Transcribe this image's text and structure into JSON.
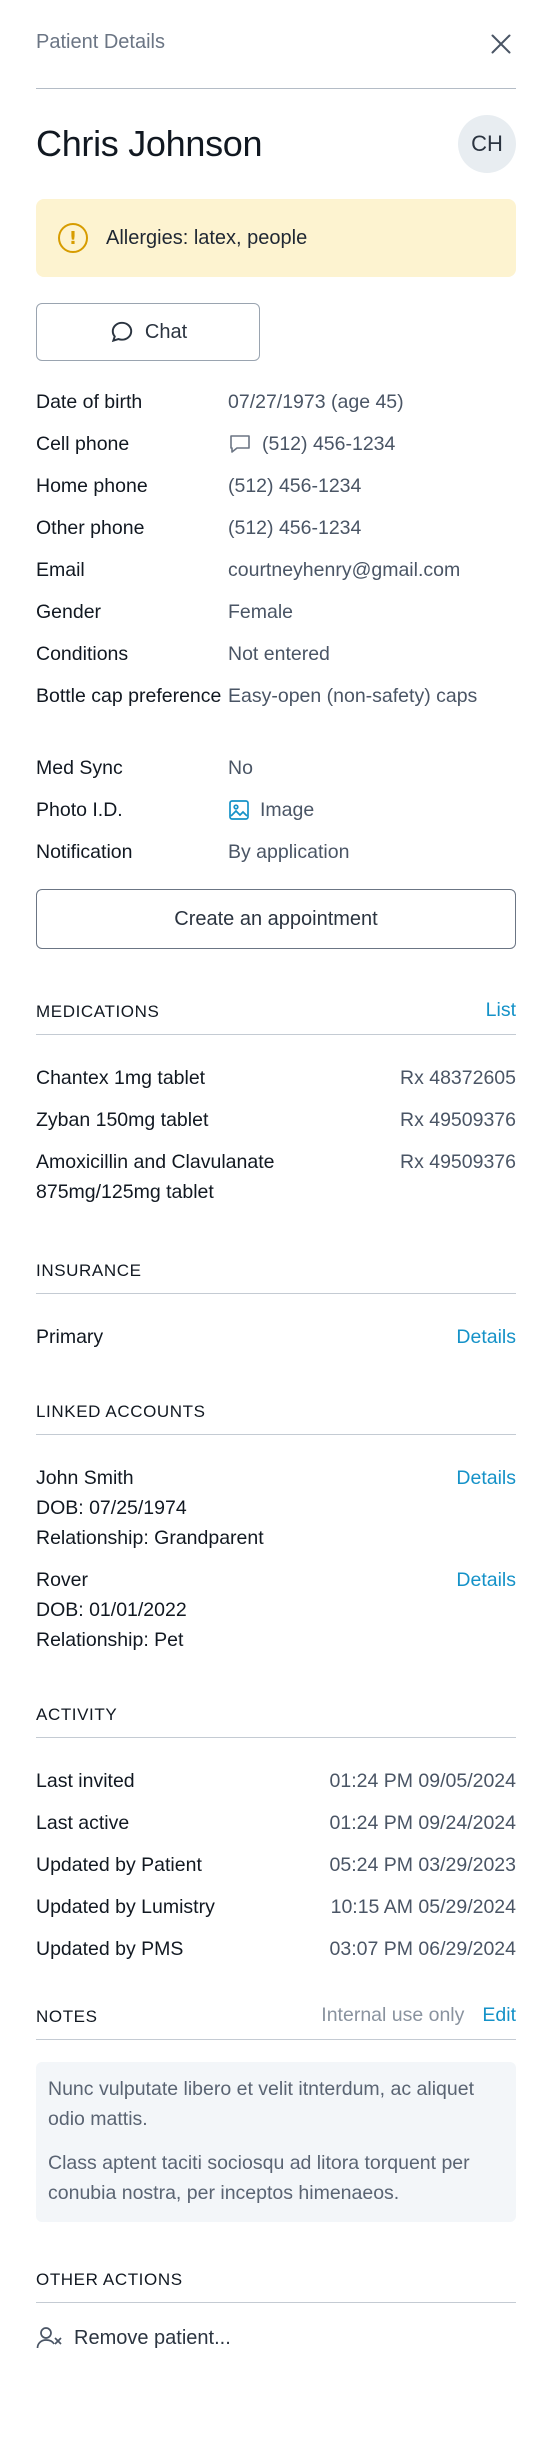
{
  "header": {
    "title": "Patient Details"
  },
  "patient": {
    "name": "Chris Johnson",
    "initials": "CH",
    "allergy_text": "Allergies: latex, people"
  },
  "chat_label": "Chat",
  "fields": [
    {
      "label": "Date of birth",
      "value": "07/27/1973 (age 45)"
    },
    {
      "label": "Cell phone",
      "value": "(512) 456-1234"
    },
    {
      "label": "Home phone",
      "value": "(512) 456-1234"
    },
    {
      "label": "Other phone",
      "value": "(512) 456-1234"
    },
    {
      "label": "Email",
      "value": "courtneyhenry@gmail.com"
    },
    {
      "label": "Gender",
      "value": "Female"
    },
    {
      "label": "Conditions",
      "value": "Not entered"
    },
    {
      "label": "Bottle cap preference",
      "value": "Easy-open (non-safety) caps"
    },
    {
      "label": "Med Sync",
      "value": "No"
    },
    {
      "label": "Photo I.D.",
      "value": "Image"
    },
    {
      "label": "Notification",
      "value": "By application"
    }
  ],
  "appointment_label": "Create an appointment",
  "medications": {
    "title": "MEDICATIONS",
    "action": "List",
    "items": [
      {
        "name": "Chantex 1mg tablet",
        "rx": "Rx 48372605"
      },
      {
        "name": "Zyban 150mg tablet",
        "rx": "Rx 49509376"
      },
      {
        "name": "Amoxicillin and Clavulanate 875mg/125mg tablet",
        "rx": "Rx 49509376"
      }
    ]
  },
  "insurance": {
    "title": "INSURANCE",
    "items": [
      {
        "label": "Primary",
        "action": "Details"
      }
    ]
  },
  "linked": {
    "title": "LINKED ACCOUNTS",
    "items": [
      {
        "name": "John Smith",
        "dob": "DOB: 07/25/1974",
        "relationship": "Relationship: Grandparent",
        "action": "Details"
      },
      {
        "name": "Rover",
        "dob": "DOB: 01/01/2022",
        "relationship": "Relationship: Pet",
        "action": "Details"
      }
    ]
  },
  "activity": {
    "title": "ACTIVITY",
    "items": [
      {
        "label": "Last invited",
        "value": "01:24 PM 09/05/2024"
      },
      {
        "label": "Last active",
        "value": "01:24 PM 09/24/2024"
      },
      {
        "label": "Updated by Patient",
        "value": "05:24 PM 03/29/2023"
      },
      {
        "label": "Updated by Lumistry",
        "value": "10:15 AM 05/29/2024"
      },
      {
        "label": "Updated by PMS",
        "value": "03:07 PM 06/29/2024"
      }
    ]
  },
  "notes": {
    "title": "NOTES",
    "hint": "Internal use only",
    "action": "Edit",
    "paragraphs": [
      "Nunc vulputate libero et velit itnterdum, ac aliquet odio mattis.",
      "Class aptent taciti sociosqu ad litora torquent per conubia nostra, per inceptos himenaeos."
    ]
  },
  "other_actions": {
    "title": "OTHER ACTIONS",
    "remove_label": "Remove patient..."
  },
  "colors": {
    "accent": "#1592c8",
    "warning_bg": "#fdf3d0",
    "warning_icon": "#d79c00"
  }
}
